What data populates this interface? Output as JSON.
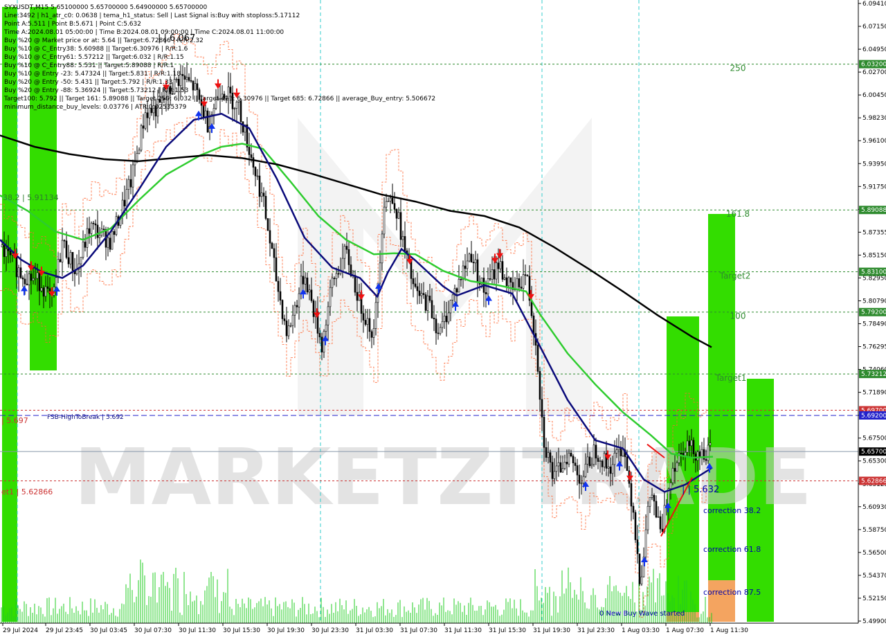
{
  "header": {
    "symbol_line": "SYXUSDT,M15  5.65100000 5.65700000 5.64900000 5.65700000",
    "lines": [
      "Line:3492 | h1_atr_c0: 0.0638 | tema_h1_status: Sell | Last Signal is:Buy with stoploss:5.17112",
      "Point A:5.511 | Point B:5.671 | Point C:5.632",
      "Time A:2024.08.01 05:00:00 | Time B:2024.08.01 09:00:00 | Time C:2024.08.01 11:00:00",
      "Buy %20 @ Market price or at: 5.64 || Target:6.72866 | R/R:2.32",
      "Buy %10 @ C_Entry38: 5.60988 || Target:6.30976 | R/R:1.6",
      "Buy %10 @ C_Entry61: 5.57212 || Target:6.032 | R/R:1.15",
      "Buy %10 @ C_Entry88: 5.531 || Target:5.89088 | R/R:1",
      "Buy %10 @ Entry -23: 5.47324 || Target:5.831 | R/R:1.18",
      "Buy %20 @ Entry -50: 5.431 || Target:5.792 | R/R:1.33",
      "Buy %20 @ Entry -88: 5.36924 || Target:5.73212 | R/R:1.53",
      "Target100: 5.792 || Target 161: 5.89088 || Target 250: 6.032 || Target 423: 6.30976 || Target 685: 6.72866 || average_Buy_entry: 5.506672",
      "minimum_distance_buy_levels: 0.03776 | ATR:0.02535379"
    ]
  },
  "watermark": "MARKETZITRADE",
  "colors": {
    "green_line": "#2ecc2e",
    "navy_line": "#0a0a7a",
    "black_line": "#000000",
    "bright_green": "#33dd00",
    "dashed_green": "#2e8b2e",
    "dashed_red": "#cc3333",
    "dashed_blue": "#2222cc",
    "orange": "#f4a460",
    "volume": "#22cc22"
  },
  "chart_data": {
    "type": "candlestick",
    "symbol": "SYXUSDT",
    "timeframe": "M15",
    "price_axis": {
      "min": 5.4909,
      "max": 6.0941,
      "tick_labels": [
        "6.09410",
        "6.07150",
        "6.04950",
        "6.02700",
        "6.00450",
        "5.98230",
        "5.96100",
        "5.93950",
        "5.91750",
        "5.89550",
        "5.87355",
        "5.85150",
        "5.82950",
        "5.80790",
        "5.78490",
        "5.76295",
        "5.74060",
        "5.71890",
        "5.69700",
        "5.67500",
        "5.65300",
        "5.63125",
        "5.60930",
        "5.58750",
        "5.56500",
        "5.54370",
        "5.52150",
        "5.49900"
      ]
    },
    "time_axis": {
      "labels": [
        "29 Jul 2024",
        "29 Jul 23:45",
        "30 Jul 03:45",
        "30 Jul 07:30",
        "30 Jul 11:30",
        "30 Jul 15:30",
        "30 Jul 19:30",
        "30 Jul 23:30",
        "31 Jul 03:30",
        "31 Jul 07:30",
        "31 Jul 11:30",
        "31 Jul 15:30",
        "31 Jul 19:30",
        "31 Jul 23:30",
        "1 Aug 03:30",
        "1 Aug 07:30",
        "1 Aug 11:30"
      ]
    },
    "price_tags": [
      {
        "value": "6.03200",
        "kind": "green"
      },
      {
        "value": "5.89088",
        "kind": "green"
      },
      {
        "value": "5.83100",
        "kind": "green"
      },
      {
        "value": "5.79200",
        "kind": "green"
      },
      {
        "value": "5.73212",
        "kind": "green"
      },
      {
        "value": "5.69700",
        "kind": "red"
      },
      {
        "value": "5.69200",
        "kind": "blue"
      },
      {
        "value": "5.65700",
        "kind": "black"
      },
      {
        "value": "5.62866",
        "kind": "red"
      }
    ],
    "levels": [
      {
        "price": 6.032,
        "label": "250"
      },
      {
        "price": 5.89088,
        "label": "161.8"
      },
      {
        "price": 5.831,
        "label": "Target2"
      },
      {
        "price": 5.792,
        "label": "100"
      },
      {
        "price": 5.73212,
        "label": "Target1"
      },
      {
        "price": 5.697,
        "label": "",
        "style": "red"
      },
      {
        "price": 5.692,
        "label": "",
        "style": "blue"
      },
      {
        "price": 5.62866,
        "label": "",
        "style": "red"
      }
    ],
    "annotations": [
      {
        "text": "38.2 | 5.91134"
      },
      {
        "text": "FSB-HighToBreak | 5.692"
      },
      {
        "text": "| 5.697"
      },
      {
        "text": "et1 | 5.62866"
      },
      {
        "text": "| | 6.067"
      },
      {
        "text": "| | 5.632"
      },
      {
        "text": "correction 38.2"
      },
      {
        "text": "correction 61.8"
      },
      {
        "text": "correction 87.5"
      },
      {
        "text": "0 New Buy Wave started"
      }
    ],
    "moving_averages": {
      "black": [
        [
          0,
          5.963
        ],
        [
          50,
          5.952
        ],
        [
          100,
          5.945
        ],
        [
          150,
          5.94
        ],
        [
          200,
          5.938
        ],
        [
          250,
          5.941
        ],
        [
          300,
          5.944
        ],
        [
          350,
          5.941
        ],
        [
          400,
          5.935
        ],
        [
          450,
          5.926
        ],
        [
          500,
          5.916
        ],
        [
          550,
          5.906
        ],
        [
          600,
          5.899
        ],
        [
          650,
          5.89
        ],
        [
          700,
          5.885
        ],
        [
          750,
          5.874
        ],
        [
          800,
          5.855
        ],
        [
          850,
          5.834
        ],
        [
          900,
          5.812
        ],
        [
          950,
          5.789
        ],
        [
          1000,
          5.768
        ],
        [
          1028,
          5.758
        ]
      ],
      "green": [
        [
          0,
          5.905
        ],
        [
          40,
          5.89
        ],
        [
          80,
          5.87
        ],
        [
          120,
          5.862
        ],
        [
          160,
          5.873
        ],
        [
          200,
          5.9
        ],
        [
          240,
          5.925
        ],
        [
          290,
          5.944
        ],
        [
          320,
          5.952
        ],
        [
          350,
          5.955
        ],
        [
          380,
          5.95
        ],
        [
          420,
          5.918
        ],
        [
          460,
          5.885
        ],
        [
          500,
          5.862
        ],
        [
          540,
          5.848
        ],
        [
          570,
          5.849
        ],
        [
          600,
          5.848
        ],
        [
          640,
          5.832
        ],
        [
          680,
          5.822
        ],
        [
          720,
          5.818
        ],
        [
          760,
          5.812
        ],
        [
          780,
          5.79
        ],
        [
          820,
          5.752
        ],
        [
          860,
          5.722
        ],
        [
          900,
          5.695
        ],
        [
          940,
          5.673
        ],
        [
          970,
          5.655
        ],
        [
          1000,
          5.651
        ],
        [
          1030,
          5.652
        ]
      ],
      "navy": [
        [
          0,
          5.862
        ],
        [
          30,
          5.843
        ],
        [
          60,
          5.831
        ],
        [
          90,
          5.825
        ],
        [
          120,
          5.837
        ],
        [
          160,
          5.87
        ],
        [
          200,
          5.91
        ],
        [
          240,
          5.952
        ],
        [
          280,
          5.978
        ],
        [
          320,
          5.984
        ],
        [
          360,
          5.97
        ],
        [
          400,
          5.921
        ],
        [
          440,
          5.864
        ],
        [
          480,
          5.835
        ],
        [
          520,
          5.825
        ],
        [
          545,
          5.807
        ],
        [
          560,
          5.83
        ],
        [
          580,
          5.853
        ],
        [
          600,
          5.842
        ],
        [
          640,
          5.817
        ],
        [
          660,
          5.808
        ],
        [
          700,
          5.818
        ],
        [
          740,
          5.81
        ],
        [
          780,
          5.759
        ],
        [
          820,
          5.707
        ],
        [
          860,
          5.668
        ],
        [
          900,
          5.66
        ],
        [
          930,
          5.63
        ],
        [
          960,
          5.618
        ],
        [
          990,
          5.625
        ],
        [
          1028,
          5.641
        ]
      ]
    },
    "candles_summary": "Price rallies from ~5.82 to ~6.06 on 30 Jul, drops to ~5.73 by 31 Jul 00:00, recovers to ~5.87, declines to ~5.52 on 1 Aug 03:30 and rebounds to 5.657."
  }
}
